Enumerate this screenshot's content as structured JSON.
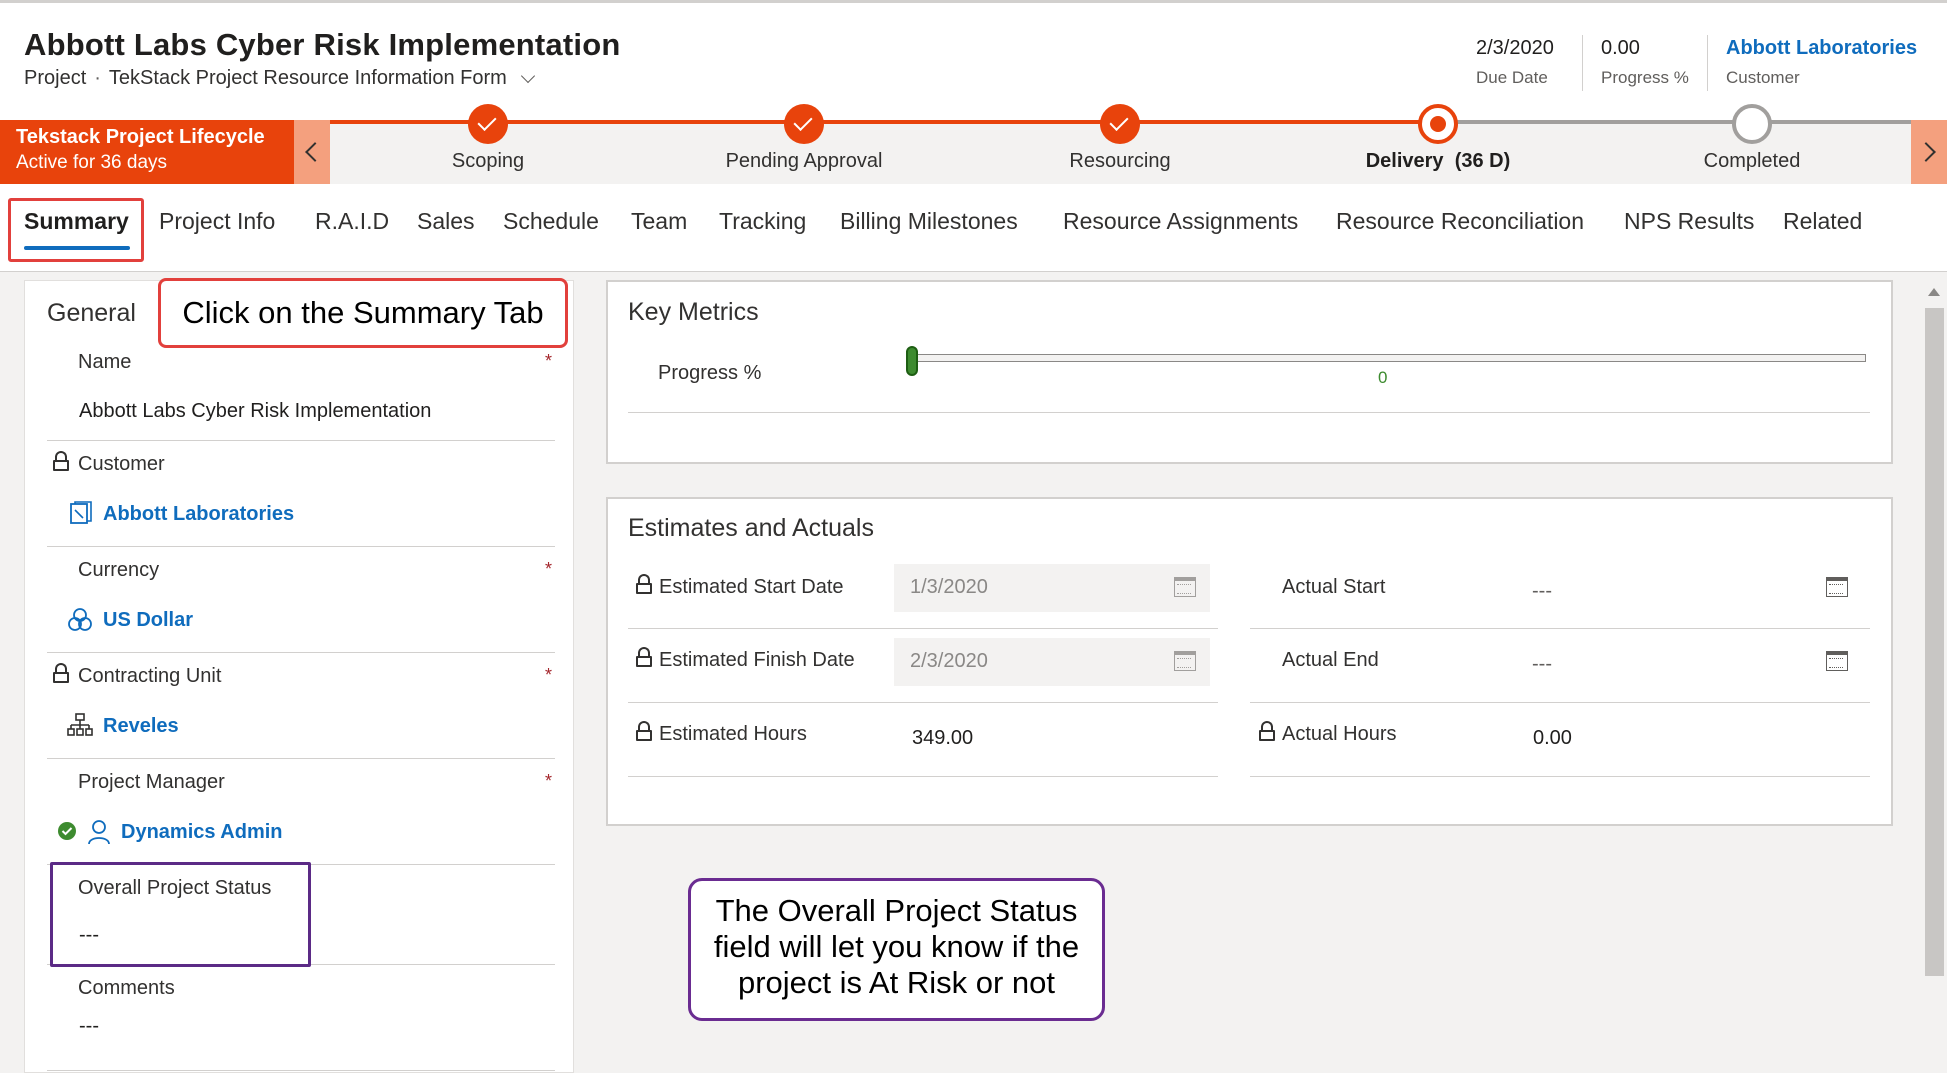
{
  "header": {
    "title": "Abbott Labs Cyber Risk Implementation",
    "entity": "Project",
    "separator": "·",
    "form_name": "TekStack Project Resource Information Form",
    "due_date": {
      "value": "2/3/2020",
      "label": "Due Date"
    },
    "progress": {
      "value": "0.00",
      "label": "Progress %"
    },
    "customer": {
      "value": "Abbott Laboratories",
      "label": "Customer"
    }
  },
  "process": {
    "name": "Tekstack Project Lifecycle",
    "status": "Active for 36 days",
    "stages": [
      {
        "label": "Scoping",
        "state": "done"
      },
      {
        "label": "Pending Approval",
        "state": "done"
      },
      {
        "label": "Resourcing",
        "state": "done"
      },
      {
        "label": "Delivery",
        "days": "(36 D)",
        "state": "active"
      },
      {
        "label": "Completed",
        "state": "todo"
      }
    ]
  },
  "tabs": [
    "Summary",
    "Project Info",
    "R.A.I.D",
    "Sales",
    "Schedule",
    "Team",
    "Tracking",
    "Billing Milestones",
    "Resource Assignments",
    "Resource Reconciliation",
    "NPS Results",
    "Related"
  ],
  "general": {
    "title": "General",
    "required_mark": "*",
    "name": {
      "label": "Name",
      "value": "Abbott Labs Cyber Risk Implementation"
    },
    "customer": {
      "label": "Customer",
      "value": "Abbott Laboratories"
    },
    "currency": {
      "label": "Currency",
      "value": "US Dollar"
    },
    "contracting_unit": {
      "label": "Contracting Unit",
      "value": "Reveles"
    },
    "project_manager": {
      "label": "Project Manager",
      "value": "Dynamics Admin"
    },
    "overall_status": {
      "label": "Overall Project Status",
      "value": "---"
    },
    "comments": {
      "label": "Comments",
      "value": "---"
    }
  },
  "key_metrics": {
    "title": "Key Metrics",
    "progress_label": "Progress %",
    "progress_value": "0",
    "progress_fraction": 0
  },
  "estimates": {
    "title": "Estimates and Actuals",
    "est_start": {
      "label": "Estimated Start Date",
      "value": "1/3/2020"
    },
    "est_finish": {
      "label": "Estimated Finish Date",
      "value": "2/3/2020"
    },
    "est_hours": {
      "label": "Estimated Hours",
      "value": "349.00"
    },
    "act_start": {
      "label": "Actual Start",
      "value": "---"
    },
    "act_end": {
      "label": "Actual End",
      "value": "---"
    },
    "act_hours": {
      "label": "Actual Hours",
      "value": "0.00"
    }
  },
  "annotations": {
    "summary_tab": "Click on the Summary Tab",
    "status_line1": "The Overall Project Status",
    "status_line2": "field will let you know if the",
    "status_line3": "project is At Risk or not"
  },
  "colors": {
    "accent": "#e8430c",
    "link": "#0f6cbd",
    "progress": "#3d8b2f",
    "callout_red": "#e2403c",
    "callout_purple": "#6a2c91"
  }
}
